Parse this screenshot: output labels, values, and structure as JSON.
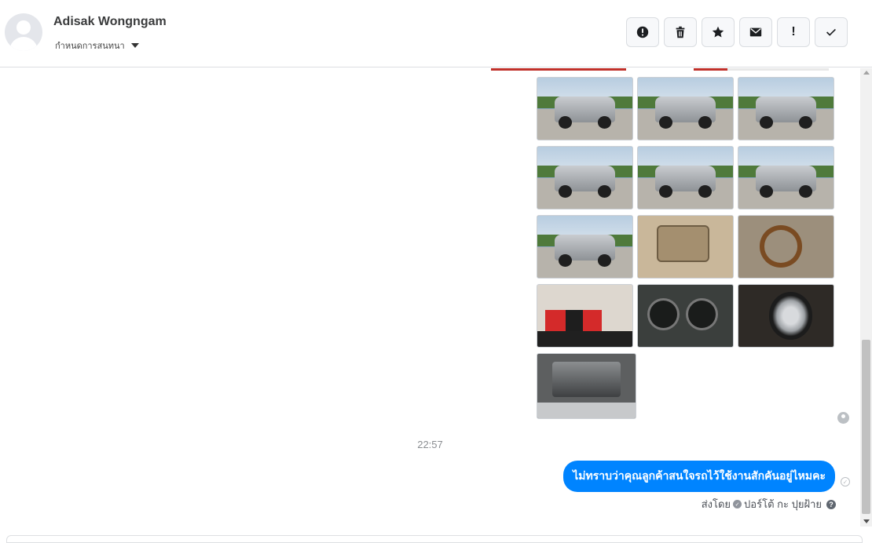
{
  "header": {
    "contact_name": "Adisak Wongngam",
    "conversation_label": "กำหนดการสนทนา",
    "toolbar": [
      {
        "name": "report-button",
        "icon": "alert-circle-icon"
      },
      {
        "name": "delete-button",
        "icon": "trash-icon"
      },
      {
        "name": "star-button",
        "icon": "star-icon"
      },
      {
        "name": "mark-unread-button",
        "icon": "envelope-icon"
      },
      {
        "name": "important-button",
        "icon": "exclamation-icon",
        "glyph": "!"
      },
      {
        "name": "done-button",
        "icon": "check-icon"
      }
    ]
  },
  "thread": {
    "photos": [
      {
        "kind": "car-front-side"
      },
      {
        "kind": "car-rear"
      },
      {
        "kind": "car-side"
      },
      {
        "kind": "car-rear-left"
      },
      {
        "kind": "car-rear"
      },
      {
        "kind": "car-front"
      },
      {
        "kind": "car-front-side"
      },
      {
        "kind": "interior-door"
      },
      {
        "kind": "steering"
      },
      {
        "kind": "seat"
      },
      {
        "kind": "dashboard"
      },
      {
        "kind": "wheel"
      },
      {
        "kind": "engine"
      }
    ],
    "timestamp": "22:57",
    "outgoing_message": "ไม่ทราบว่าคุณลูกค้าสนใจรถไว้ใช้งานสักคันอยู่ไหมคะ",
    "sent_by_prefix": "ส่งโดย",
    "sent_by_name": "ปอร์โต้ กะ ปุยฝ้าย",
    "help_glyph": "?"
  },
  "colors": {
    "bubble": "#0084ff",
    "border": "#dddfe2"
  }
}
